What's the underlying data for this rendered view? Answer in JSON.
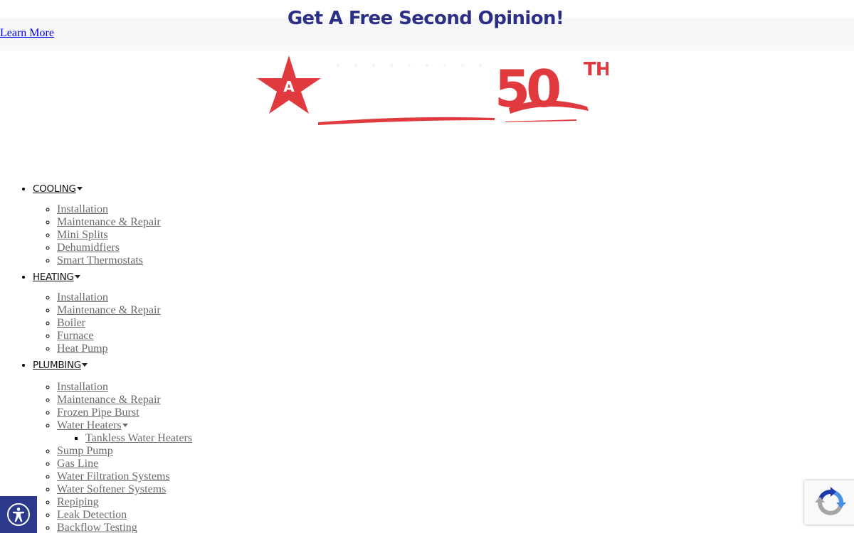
{
  "promo": {
    "title": "Get A Free Second Opinion!",
    "link_label": "Learn More"
  },
  "logo": {
    "anniversary_text": "50",
    "anniversary_suffix": "TH",
    "brand_color": "#e03a3e",
    "star_letter": "A"
  },
  "nav": {
    "cooling": {
      "label": "COOLING",
      "items": [
        "Installation",
        "Maintenance & Repair",
        "Mini Splits",
        "Dehumidfiers",
        "Smart Thermostats"
      ]
    },
    "heating": {
      "label": "HEATING",
      "items": [
        "Installation",
        "Maintenance & Repair",
        "Boiler",
        "Furnace",
        "Heat Pump"
      ]
    },
    "plumbing": {
      "label": "PLUMBING",
      "items": {
        "installation": "Installation",
        "maintenance": "Maintenance & Repair",
        "frozen_pipe": "Frozen Pipe Burst",
        "water_heaters": "Water Heaters",
        "tankless": "Tankless Water Heaters",
        "sump_pump": "Sump Pump",
        "gas_line": "Gas Line",
        "water_filtration": "Water Filtration Systems",
        "water_softener": "Water Softener Systems",
        "repiping": "Repiping",
        "leak_detection": "Leak Detection",
        "backflow": "Backflow Testing"
      }
    }
  },
  "widgets": {
    "accessibility_icon": "accessibility-icon",
    "recaptcha_icon": "recaptcha-icon"
  },
  "colors": {
    "promo_title": "#2b2f86",
    "submenu_link": "#6b6b6b",
    "accessibility_bg": "#2d3a8c"
  }
}
